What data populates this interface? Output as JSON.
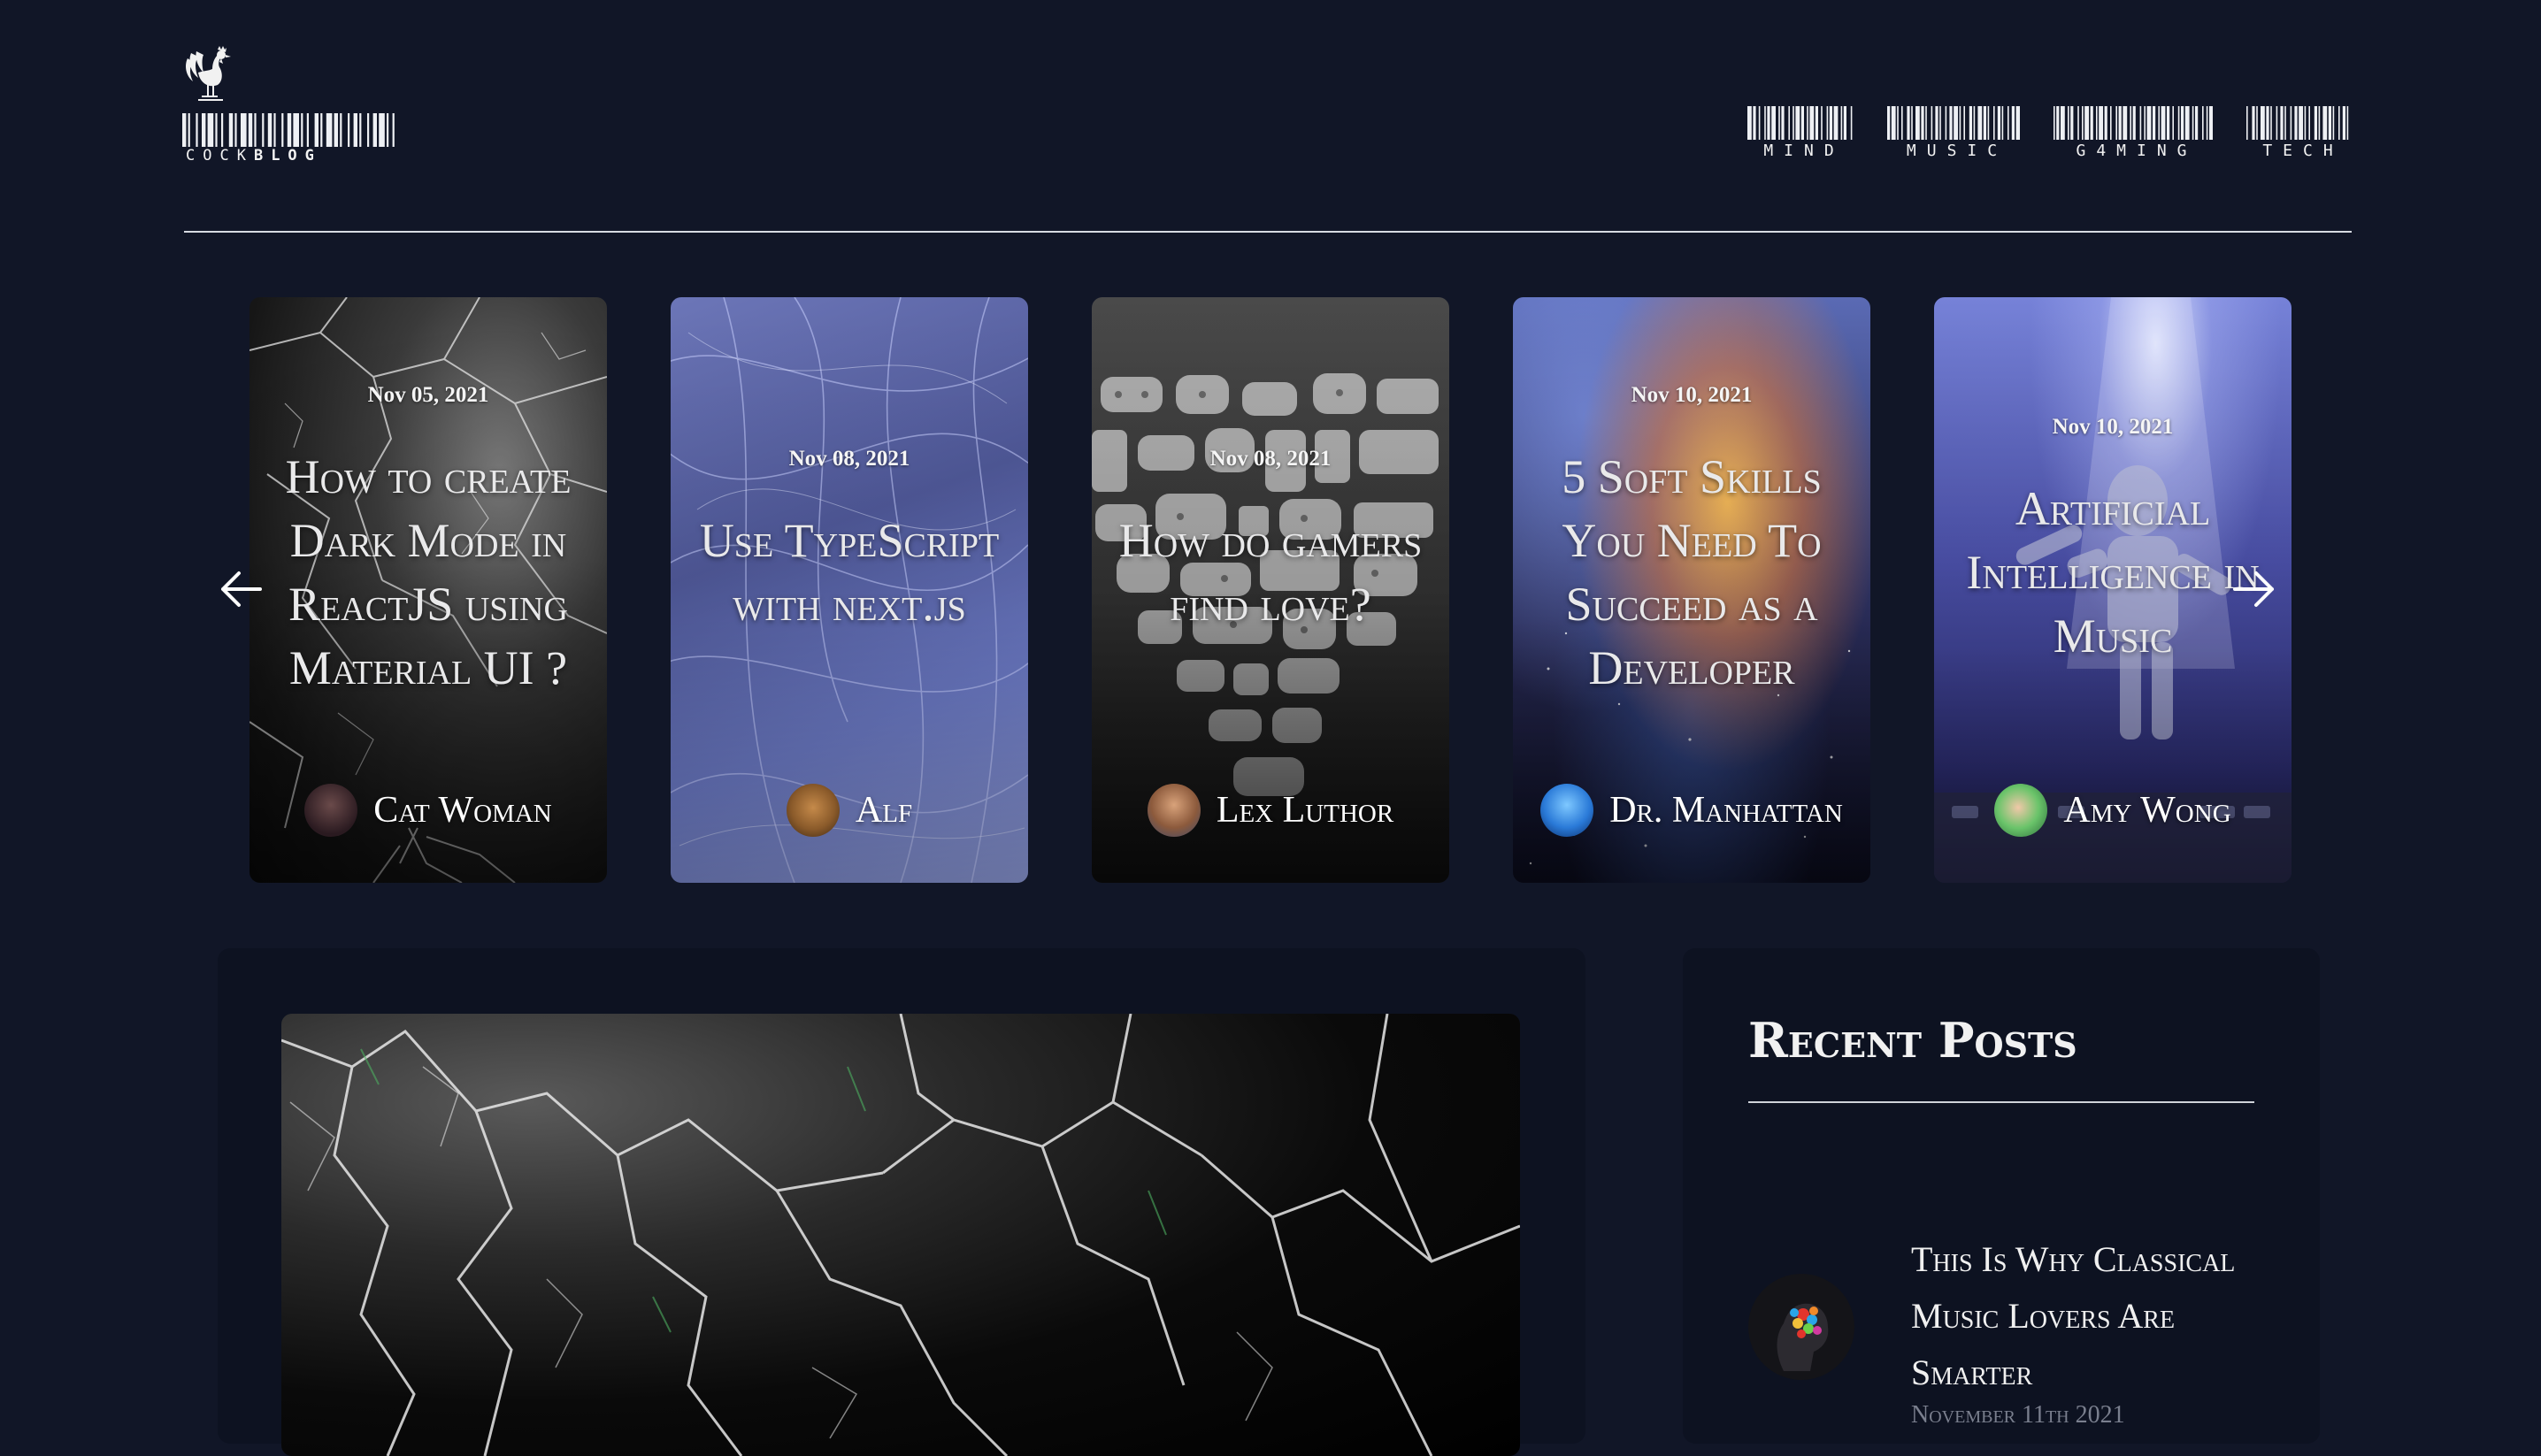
{
  "brand": {
    "logo_text_light": "COCK",
    "logo_text_bold": "BLOG",
    "logo_icon": "rooster-icon"
  },
  "nav": {
    "items": [
      {
        "label": "MIND"
      },
      {
        "label": "MUSIC"
      },
      {
        "label": "G4MING"
      },
      {
        "label": "TECH"
      }
    ]
  },
  "carousel": {
    "prev_icon": "arrow-left-icon",
    "next_icon": "arrow-right-icon",
    "cards": [
      {
        "date": "Nov 05, 2021",
        "title": "How to create Dark Mode in ReactJS using Material UI ?",
        "author": "Cat Woman",
        "theme": "cracked-glass"
      },
      {
        "date": "Nov 08, 2021",
        "title": "Use TypeScript with next.js",
        "author": "Alf",
        "theme": "blue-web"
      },
      {
        "date": "Nov 08, 2021",
        "title": "How do gamers find love?",
        "author": "Lex Luthor",
        "theme": "controllers-heart"
      },
      {
        "date": "Nov 10, 2021",
        "title": "5 Soft Skills You Need To Succeed as a Developer",
        "author": "Dr. Manhattan",
        "theme": "nebula"
      },
      {
        "date": "Nov 10, 2021",
        "title": "Artificial Intelligence in Music",
        "author": "Amy Wong",
        "theme": "robot-spotlight"
      }
    ]
  },
  "sidebar": {
    "title": "Recent Posts",
    "posts": [
      {
        "title": "This Is Why Classical Music Lovers Are Smarter",
        "date": "November 11th 2021"
      }
    ]
  },
  "colors": {
    "page_bg": "#111627",
    "panel_bg": "#0d1221",
    "text": "#ececec",
    "muted": "#7a7f8e"
  }
}
